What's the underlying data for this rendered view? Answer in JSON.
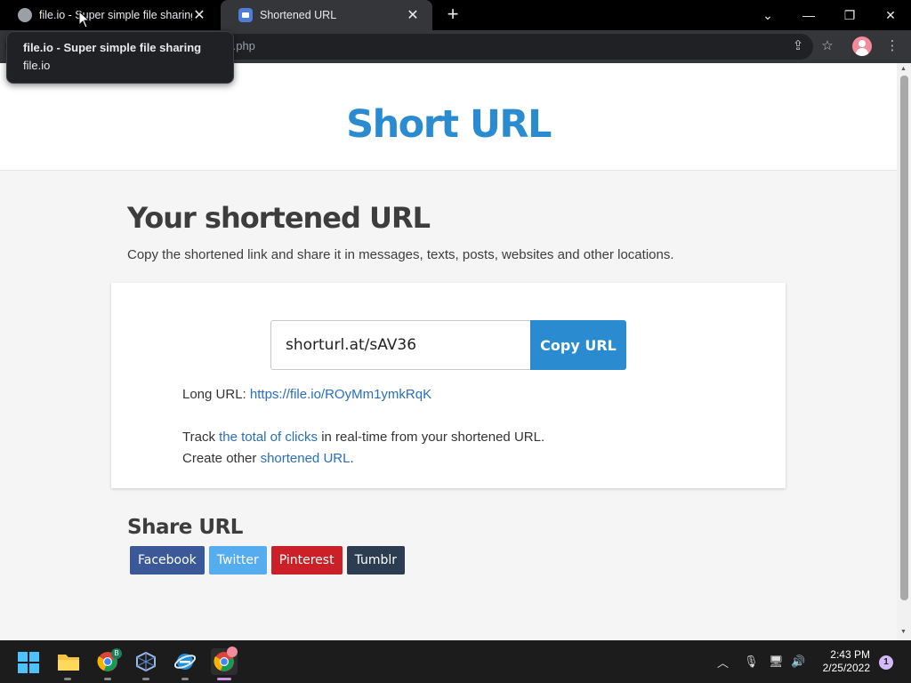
{
  "browser": {
    "tabs": [
      {
        "title": "file.io - Super simple file sharing"
      },
      {
        "title": "Shortened URL"
      }
    ],
    "url_fragment": "r.php",
    "tooltip": {
      "title": "file.io - Super simple file sharing",
      "domain": "file.io"
    }
  },
  "page": {
    "logo": "Short URL",
    "heading": "Your shortened URL",
    "description": "Copy the shortened link and share it in messages, texts, posts, websites and other locations.",
    "short_url": "shorturl.at/sAV36",
    "copy_button": "Copy URL",
    "long_url_label": "Long URL:",
    "long_url": "https://file.io/ROyMm1ymkRqK",
    "track_prefix": "Track",
    "track_link": "the total of clicks",
    "track_suffix": "in real-time from your shortened URL.",
    "create_prefix": "Create other",
    "create_link": "shortened URL",
    "create_suffix": ".",
    "share_heading": "Share URL",
    "share_buttons": [
      {
        "label": "Facebook",
        "color": "#3b5998"
      },
      {
        "label": "Twitter",
        "color": "#55acee"
      },
      {
        "label": "Pinterest",
        "color": "#cb2027"
      },
      {
        "label": "Tumblr",
        "color": "#2c3d52"
      }
    ]
  },
  "taskbar": {
    "time": "2:43 PM",
    "date": "2/25/2022",
    "notifications": "1",
    "chrome_badge": "B"
  },
  "colors": {
    "accent": "#2a8bd0",
    "link": "#2a6ebc"
  }
}
